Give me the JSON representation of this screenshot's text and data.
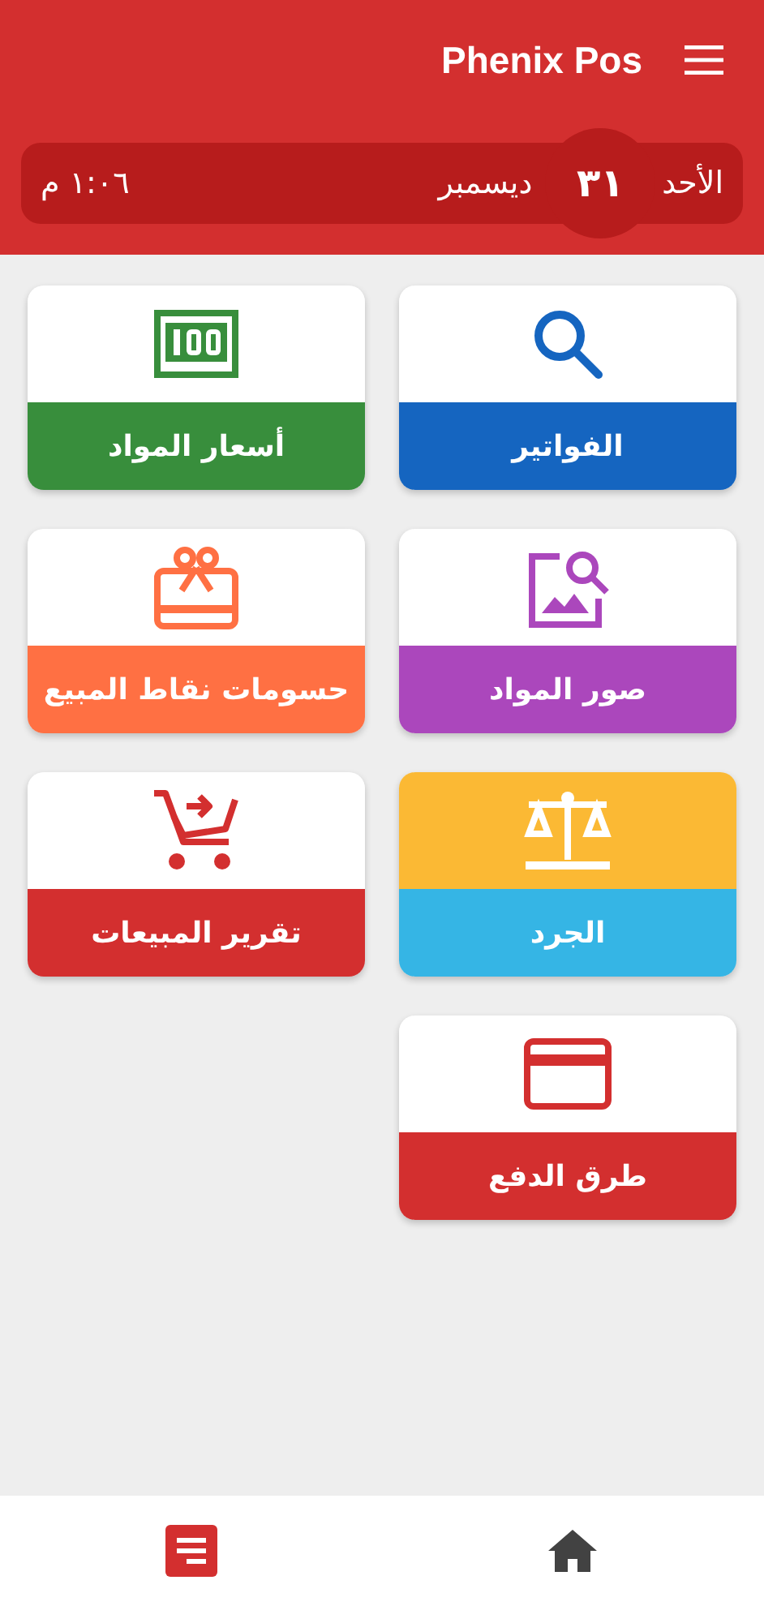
{
  "app_bar": {
    "title": "Phenix Pos"
  },
  "date_bar": {
    "weekday": "الأحد",
    "day": "٣١",
    "month": "ديسمبر",
    "time": "١:٠٦ م"
  },
  "tiles": [
    {
      "label": "الفواتير",
      "kind": "search",
      "color": "#1565c0"
    },
    {
      "label": "أسعار المواد",
      "kind": "banknote",
      "color": "#388e3c"
    },
    {
      "label": "صور المواد",
      "kind": "image-search",
      "color": "#ab47bc"
    },
    {
      "label": "حسومات نقاط المبيع",
      "kind": "gift-card",
      "color": "#ff7043"
    },
    {
      "label": "الجرد",
      "kind": "scale",
      "color": "#35b5e5"
    },
    {
      "label": "تقرير المبيعات",
      "kind": "cart",
      "color": "#d32f2f"
    },
    {
      "label": "طرق الدفع",
      "kind": "card",
      "color": "#d32f2f"
    }
  ],
  "bottom_nav": [
    {
      "kind": "list",
      "selected": true
    },
    {
      "kind": "home",
      "selected": false
    }
  ]
}
